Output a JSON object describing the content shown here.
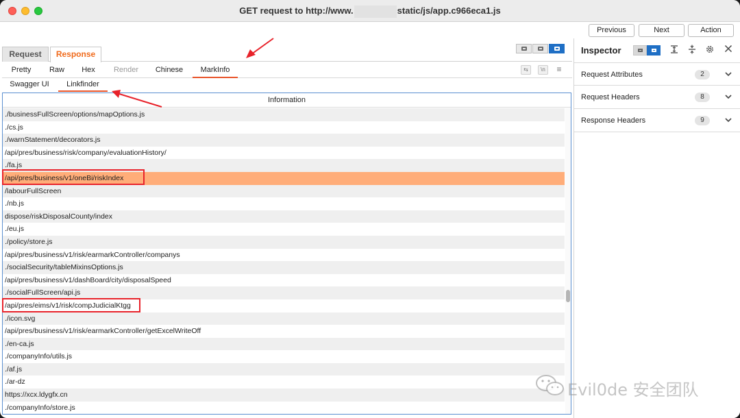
{
  "window": {
    "title_prefix": "GET request to http://www.",
    "title_suffix": "static/js/app.c966eca1.js"
  },
  "nav": {
    "previous": "Previous",
    "next": "Next",
    "action": "Action"
  },
  "req_tabs": {
    "request": "Request",
    "response": "Response"
  },
  "view_tabs": [
    "Pretty",
    "Raw",
    "Hex",
    "Render",
    "Chinese",
    "MarkInfo"
  ],
  "view_icons": {
    "wrap": "⇆",
    "newline": "\\n",
    "menu": "≡"
  },
  "sub_tabs": [
    "Swagger UI",
    "Linkfinder"
  ],
  "table": {
    "header": "Information",
    "rows": [
      "./businessFullScreen/options/mapOptions.js",
      "./cs.js",
      "./warnStatement/decorators.js",
      "/api/pres/business/risk/company/evaluationHistory/",
      "./fa.js",
      "/api/pres/business/v1/oneBi/riskIndex",
      "/labourFullScreen",
      "./nb.js",
      "dispose/riskDisposalCounty/index",
      "./eu.js",
      "./policy/store.js",
      "/api/pres/business/v1/risk/earmarkController/companys",
      "./socialSecurity/tableMixinsOptions.js",
      "/api/pres/business/v1/dashBoard/city/disposalSpeed",
      "./socialFullScreen/api.js",
      "/api/pres/eims/v1/risk/compJudicialKtgg",
      "./icon.svg",
      "/api/pres/business/v1/risk/earmarkController/getExcelWriteOff",
      "./en-ca.js",
      "./companyInfo/utils.js",
      "./af.js",
      "./ar-dz",
      "https://xcx.ldygfx.cn",
      "./companyInfo/store.js"
    ],
    "selected_row": 5,
    "highlighted_rows": [
      5,
      15
    ]
  },
  "inspector": {
    "title": "Inspector",
    "sections": [
      {
        "label": "Request Attributes",
        "count": "2"
      },
      {
        "label": "Request Headers",
        "count": "8"
      },
      {
        "label": "Response Headers",
        "count": "9"
      }
    ]
  },
  "watermark": {
    "text": "Evil0de 安全团队"
  },
  "colors": {
    "accent": "#f06a1b",
    "selected_row": "#ffad79",
    "highlight_box": "#e8222a",
    "toggle_on": "#1f6fc5"
  }
}
